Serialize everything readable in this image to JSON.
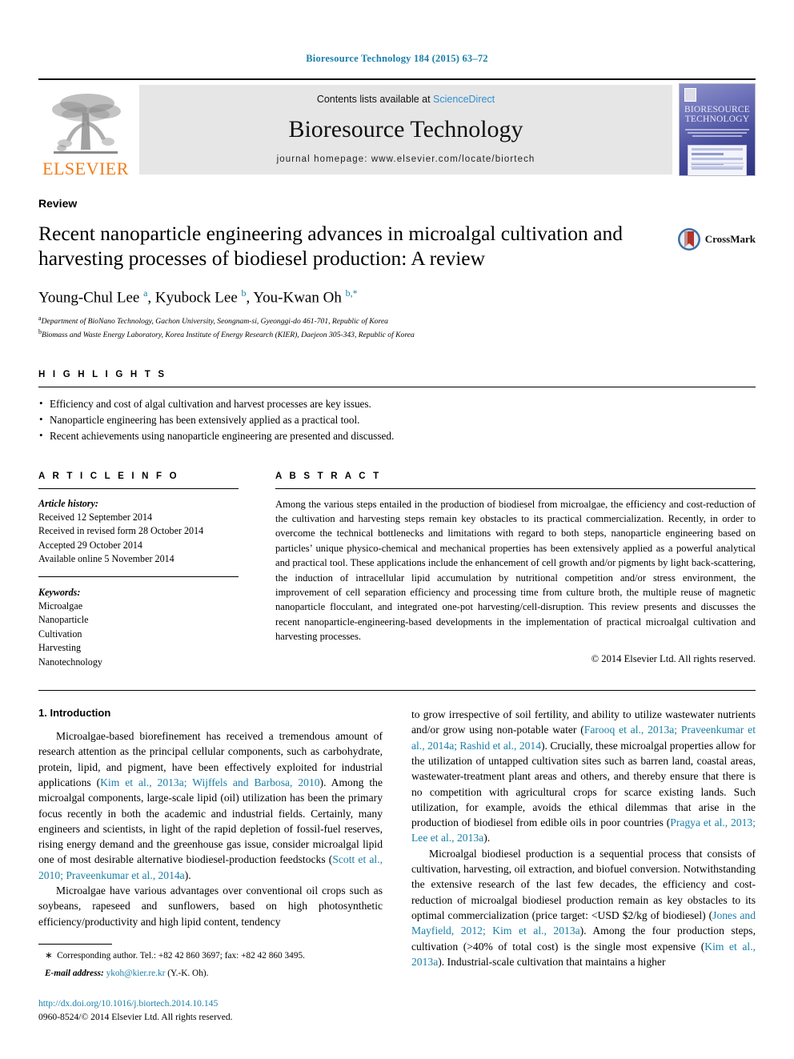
{
  "running_head": "Bioresource Technology 184 (2015) 63–72",
  "masthead": {
    "contents_prefix": "Contents lists available at ",
    "sciencedirect": "ScienceDirect",
    "journal_name": "Bioresource Technology",
    "homepage": "journal homepage: www.elsevier.com/locate/biortech",
    "publisher": "ELSEVIER",
    "cover_title_line1": "BIORESOURCE",
    "cover_title_line2": "TECHNOLOGY",
    "accent_blue": "#2f8fd0",
    "elsevier_orange": "#f07d1a"
  },
  "article": {
    "type": "Review",
    "title": "Recent nanoparticle engineering advances in microalgal cultivation and harvesting processes of biodiesel production: A review",
    "crossmark_label": "CrossMark",
    "authors_html": "Young-Chul Lee <sup>a</sup>, Kyubock Lee <sup>b</sup>, You-Kwan Oh <sup>b,*</sup>",
    "affiliations": [
      "Department of BioNano Technology, Gachon University, Seongnam-si, Gyeonggi-do 461-701, Republic of Korea",
      "Biomass and Waste Energy Laboratory, Korea Institute of Energy Research (KIER), Daejeon 305-343, Republic of Korea"
    ]
  },
  "highlights": {
    "heading": "H I G H L I G H T S",
    "items": [
      "Efficiency and cost of algal cultivation and harvest processes are key issues.",
      "Nanoparticle engineering has been extensively applied as a practical tool.",
      "Recent achievements using nanoparticle engineering are presented and discussed."
    ]
  },
  "article_info": {
    "heading": "A R T I C L E    I N F O",
    "history_label": "Article history:",
    "history": [
      "Received 12 September 2014",
      "Received in revised form 28 October 2014",
      "Accepted 29 October 2014",
      "Available online 5 November 2014"
    ],
    "keywords_label": "Keywords:",
    "keywords": [
      "Microalgae",
      "Nanoparticle",
      "Cultivation",
      "Harvesting",
      "Nanotechnology"
    ]
  },
  "abstract": {
    "heading": "A B S T R A C T",
    "text": "Among the various steps entailed in the production of biodiesel from microalgae, the efficiency and cost-reduction of the cultivation and harvesting steps remain key obstacles to its practical commercialization. Recently, in order to overcome the technical bottlenecks and limitations with regard to both steps, nanoparticle engineering based on particles’ unique physico-chemical and mechanical properties has been extensively applied as a powerful analytical and practical tool. These applications include the enhancement of cell growth and/or pigments by light back-scattering, the induction of intracellular lipid accumulation by nutritional competition and/or stress environment, the improvement of cell separation efficiency and processing time from culture broth, the multiple reuse of magnetic nanoparticle flocculant, and integrated one-pot harvesting/cell-disruption. This review presents and discusses the recent nanoparticle-engineering-based developments in the implementation of practical microalgal cultivation and harvesting processes.",
    "copyright": "© 2014 Elsevier Ltd. All rights reserved."
  },
  "body": {
    "section_title": "1. Introduction",
    "left_paragraphs": [
      "Microalgae-based biorefinement has received a tremendous amount of research attention as the principal cellular components, such as carbohydrate, protein, lipid, and pigment, have been effectively exploited for industrial applications (<span class=\"ref\">Kim et al., 2013a; Wijffels and Barbosa, 2010</span>). Among the microalgal components, large-scale lipid (oil) utilization has been the primary focus recently in both the academic and industrial fields. Certainly, many engineers and scientists, in light of the rapid depletion of fossil-fuel reserves, rising energy demand and the greenhouse gas issue, consider microalgal lipid one of most desirable alternative biodiesel-production feedstocks (<span class=\"ref\">Scott et al., 2010; Praveenkumar et al., 2014a</span>).",
      "Microalgae have various advantages over conventional oil crops such as soybeans, rapeseed and sunflowers, based on high photosynthetic efficiency/productivity and high lipid content, tendency"
    ],
    "right_paragraphs": [
      "to grow irrespective of soil fertility, and ability to utilize wastewater nutrients and/or grow using non-potable water (<span class=\"ref\">Farooq et al., 2013a; Praveenkumar et al., 2014a; Rashid et al., 2014</span>). Crucially, these microalgal properties allow for the utilization of untapped cultivation sites such as barren land, coastal areas, wastewater-treatment plant areas and others, and thereby ensure that there is no competition with agricultural crops for scarce existing lands. Such utilization, for example, avoids the ethical dilemmas that arise in the production of biodiesel from edible oils in poor countries (<span class=\"ref\">Pragya et al., 2013; Lee et al., 2013a</span>).",
      "Microalgal biodiesel production is a sequential process that consists of cultivation, harvesting, oil extraction, and biofuel conversion. Notwithstanding the extensive research of the last few decades, the efficiency and cost-reduction of microalgal biodiesel production remain as key obstacles to its optimal commercialization (price target: &lt;USD $2/kg of biodiesel) (<span class=\"ref\">Jones and Mayfield, 2012; Kim et al., 2013a</span>). Among the four production steps, cultivation (&gt;40% of total cost) is the single most expensive (<span class=\"ref\">Kim et al., 2013a</span>). Industrial-scale cultivation that maintains a higher"
    ]
  },
  "footer": {
    "corresponding_html": "<span class=\"em\" style=\"font-style:normal;font-weight:normal\">&#8727;</span>&nbsp; Corresponding author. Tel.: +82 42 860 3697; fax: +82 42 860 3495.",
    "email_label": "E-mail address:",
    "email": "ykoh@kier.re.kr",
    "email_suffix": "(Y.-K. Oh).",
    "doi": "http://dx.doi.org/10.1016/j.biortech.2014.10.145",
    "issn_line": "0960-8524/© 2014 Elsevier Ltd. All rights reserved."
  }
}
